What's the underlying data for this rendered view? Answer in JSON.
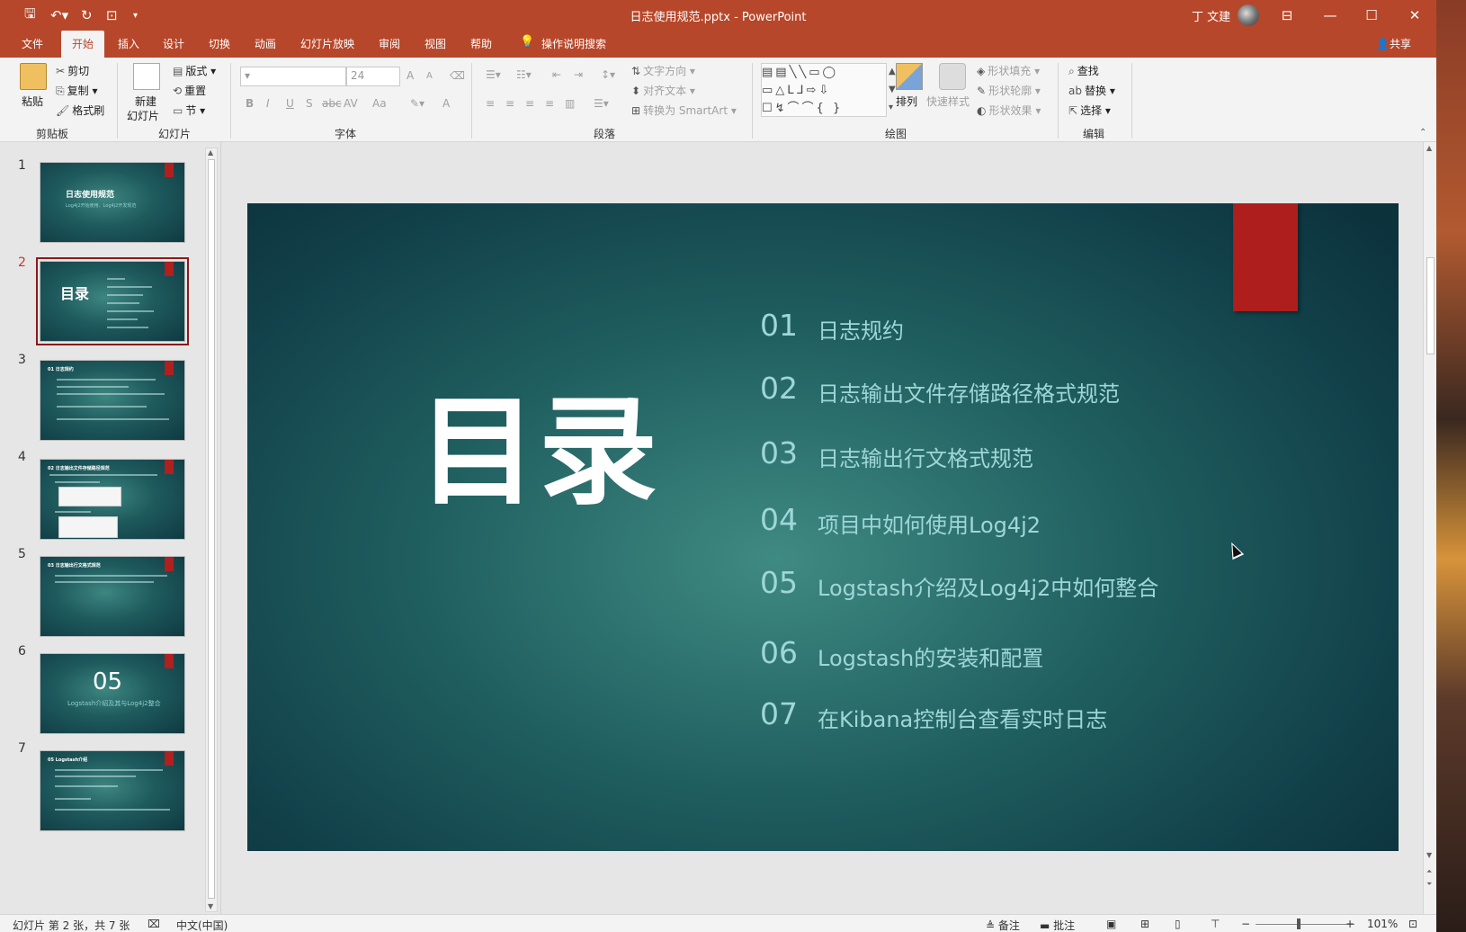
{
  "window": {
    "title": "日志使用规范.pptx  -  PowerPoint",
    "user": "丁 文建",
    "share": "共享",
    "tell_me": "操作说明搜索"
  },
  "tabs": [
    "文件",
    "开始",
    "插入",
    "设计",
    "切换",
    "动画",
    "幻灯片放映",
    "审阅",
    "视图",
    "帮助"
  ],
  "active_tab": "开始",
  "ribbon": {
    "clipboard": {
      "paste": "粘贴",
      "cut": "剪切",
      "copy": "复制",
      "format_painter": "格式刷",
      "group": "剪贴板"
    },
    "slides": {
      "new_slide_1": "新建",
      "new_slide_2": "幻灯片",
      "layout": "版式",
      "reset": "重置",
      "section": "节",
      "group": "幻灯片"
    },
    "font": {
      "font_size": "24",
      "group": "字体",
      "bold": "B",
      "italic": "I",
      "underline": "U",
      "shadow": "S",
      "strike": "abc",
      "spacing": "AV",
      "case": "Aa",
      "grow": "A",
      "shrink": "A",
      "color": "A"
    },
    "paragraph": {
      "text_direction": "文字方向",
      "align_text": "对齐文本",
      "smartart": "转换为 SmartArt",
      "group": "段落"
    },
    "drawing": {
      "arrange": "排列",
      "quick_styles": "快速样式",
      "shape_fill": "形状填充",
      "shape_outline": "形状轮廓",
      "shape_effects": "形状效果",
      "group": "绘图"
    },
    "editing": {
      "find": "查找",
      "replace": "替换",
      "select": "选择",
      "group": "编辑"
    }
  },
  "thumbnails": [
    {
      "num": "1",
      "title": "日志使用规范",
      "subtitle": "Log4j2开始使用、Log4j2开发规范"
    },
    {
      "num": "2",
      "title": "目录"
    },
    {
      "num": "3",
      "title": "01 日志规约"
    },
    {
      "num": "4",
      "title": "02 日志输出文件存储路径规范"
    },
    {
      "num": "5",
      "title": "03 日志输出行文格式规范"
    },
    {
      "num": "6",
      "title": "05",
      "subtitle": "Logstash介绍及其与Log4j2整合"
    },
    {
      "num": "7",
      "title": "05 Logstash介绍"
    }
  ],
  "slide": {
    "heading": "目录",
    "items": [
      {
        "num": "01",
        "text": "日志规约"
      },
      {
        "num": "02",
        "text": "日志输出文件存储路径格式规范"
      },
      {
        "num": "03",
        "text": "日志输出行文格式规范"
      },
      {
        "num": "04",
        "text": "项目中如何使用Log4j2"
      },
      {
        "num": "05",
        "text": "Logstash介绍及Log4j2中如何整合"
      },
      {
        "num": "06",
        "text": "Logstash的安装和配置"
      },
      {
        "num": "07",
        "text": "在Kibana控制台查看实时日志"
      }
    ]
  },
  "status": {
    "slide_info": "幻灯片 第 2 张，共 7 张",
    "language": "中文(中国)",
    "notes": "备注",
    "comments": "批注",
    "zoom": "101%"
  },
  "colors": {
    "accent": "#b7472a",
    "slide_red": "#ad1e1c",
    "toc_text": "#9fd6d8"
  }
}
